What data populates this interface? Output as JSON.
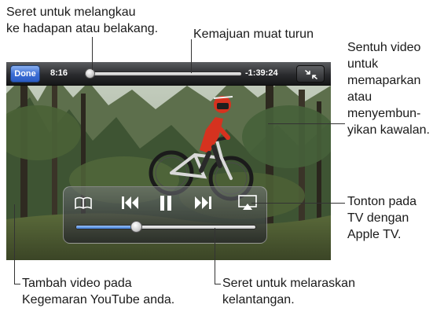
{
  "callouts": {
    "scrub": [
      "Seret untuk melangkau",
      "ke hadapan atau belakang."
    ],
    "download_progress": [
      "Kemajuan muat turun"
    ],
    "tap_video": [
      "Sentuh video",
      "untuk",
      "memaparkan",
      "atau",
      "menyembun-",
      "yikan kawalan."
    ],
    "airplay": [
      "Tonton pada",
      "TV dengan",
      "Apple TV."
    ],
    "bookmark": [
      "Tambah video pada",
      "Kegemaran YouTube anda."
    ],
    "volume": [
      "Seret untuk melaraskan",
      "kelantangan."
    ]
  },
  "player": {
    "done_label": "Done",
    "elapsed": "8:16",
    "remaining": "-1:39:24",
    "playback_progress": 0.06,
    "volume": 0.34
  },
  "icons": {
    "exit_fullscreen": "exit-fullscreen-icon",
    "bookmark": "book-icon",
    "previous": "skip-back-icon",
    "pause": "pause-icon",
    "next": "skip-forward-icon",
    "airplay": "airplay-icon"
  },
  "colors": {
    "accent_blue": "#3f7fd8",
    "done_button": "#3d6fd6",
    "rider_jersey": "#d6321f"
  }
}
